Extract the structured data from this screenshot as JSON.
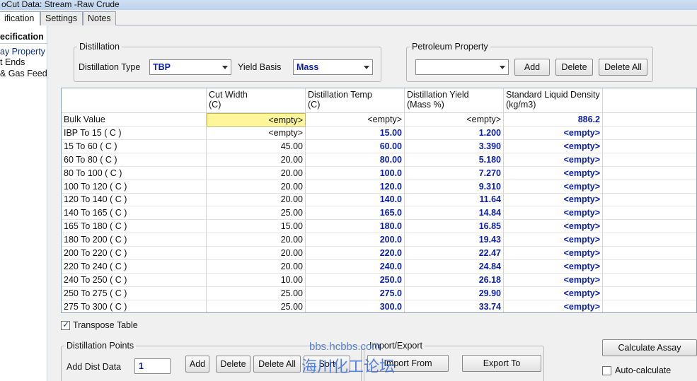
{
  "window": {
    "title": "oCut Data: Stream -Raw Crude"
  },
  "tabs": [
    {
      "label": "ification"
    },
    {
      "label": "Settings"
    },
    {
      "label": "Notes"
    }
  ],
  "leftnav": {
    "header": "ecification",
    "items": [
      {
        "label": "ay Property"
      },
      {
        "label": "t Ends"
      },
      {
        "label": "& Gas Feed"
      }
    ]
  },
  "distillation": {
    "legend": "Distillation",
    "type_label": "Distillation Type",
    "type_value": "TBP",
    "yield_label": "Yield Basis",
    "yield_value": "Mass"
  },
  "petroleum": {
    "legend": "Petroleum Property",
    "selected": "",
    "add": "Add",
    "delete": "Delete",
    "delete_all": "Delete All"
  },
  "table": {
    "headers": [
      {
        "line1": "Cut Width",
        "line2": "(C)"
      },
      {
        "line1": "Distillation Temp",
        "line2": "(C)"
      },
      {
        "line1": "Distillation Yield",
        "line2": "(Mass %)"
      },
      {
        "line1": "Standard Liquid Density",
        "line2": "(kg/m3)"
      }
    ],
    "rows": [
      {
        "label": "Bulk Value",
        "cut": "<empty>",
        "temp": "<empty>",
        "yield": "<empty>",
        "dens": "886.2"
      },
      {
        "label": "IBP  To    15  ( C )",
        "cut": "<empty>",
        "temp": "15.00",
        "yield": "1.200",
        "dens": "<empty>"
      },
      {
        "label": "15  To    60  ( C )",
        "cut": "45.00",
        "temp": "60.00",
        "yield": "3.390",
        "dens": "<empty>"
      },
      {
        "label": "60  To    80  ( C )",
        "cut": "20.00",
        "temp": "80.00",
        "yield": "5.180",
        "dens": "<empty>"
      },
      {
        "label": "80  To   100  ( C )",
        "cut": "20.00",
        "temp": "100.0",
        "yield": "7.270",
        "dens": "<empty>"
      },
      {
        "label": "100  To   120  ( C )",
        "cut": "20.00",
        "temp": "120.0",
        "yield": "9.310",
        "dens": "<empty>"
      },
      {
        "label": "120  To   140  ( C )",
        "cut": "20.00",
        "temp": "140.0",
        "yield": "11.64",
        "dens": "<empty>"
      },
      {
        "label": "140  To   165  ( C )",
        "cut": "25.00",
        "temp": "165.0",
        "yield": "14.84",
        "dens": "<empty>"
      },
      {
        "label": "165  To   180  ( C )",
        "cut": "15.00",
        "temp": "180.0",
        "yield": "16.85",
        "dens": "<empty>"
      },
      {
        "label": "180  To   200  ( C )",
        "cut": "20.00",
        "temp": "200.0",
        "yield": "19.43",
        "dens": "<empty>"
      },
      {
        "label": "200  To   220  ( C )",
        "cut": "20.00",
        "temp": "220.0",
        "yield": "22.47",
        "dens": "<empty>"
      },
      {
        "label": "220  To   240  ( C )",
        "cut": "20.00",
        "temp": "240.0",
        "yield": "24.84",
        "dens": "<empty>"
      },
      {
        "label": "240  To   250  ( C )",
        "cut": "10.00",
        "temp": "250.0",
        "yield": "26.18",
        "dens": "<empty>"
      },
      {
        "label": "250  To   275  ( C )",
        "cut": "25.00",
        "temp": "275.0",
        "yield": "29.90",
        "dens": "<empty>"
      },
      {
        "label": "275  To   300  ( C )",
        "cut": "25.00",
        "temp": "300.0",
        "yield": "33.74",
        "dens": "<empty>"
      }
    ]
  },
  "transpose": {
    "label": "Transpose Table",
    "checked": true
  },
  "dist_points": {
    "legend": "Distillation Points",
    "add_label": "Add Dist Data",
    "add_value": "1",
    "add": "Add",
    "delete": "Delete",
    "delete_all": "Delete All",
    "sort": "Sort"
  },
  "import_export": {
    "legend": "Import/Export",
    "import_from": "Import From",
    "export_to": "Export To"
  },
  "calc": {
    "calculate": "Calculate Assay",
    "auto_label": "Auto-calculate",
    "auto_checked": false
  },
  "watermark": {
    "line1": "bbs.hcbbs.com",
    "line2": "海川化工论坛"
  }
}
